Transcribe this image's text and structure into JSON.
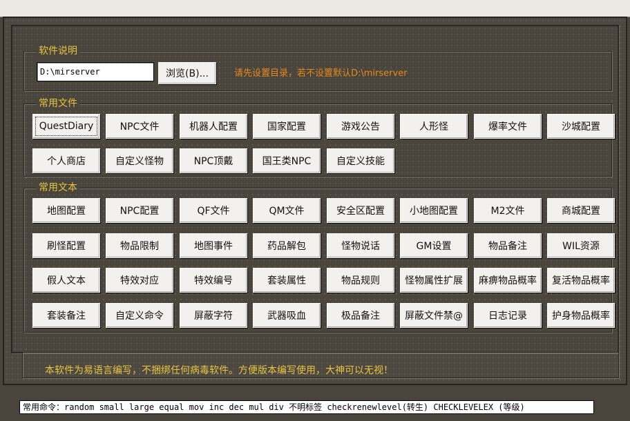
{
  "intro": {
    "title": "软件说明",
    "path_value": "D:\\mirserver",
    "browse_label": "浏览(B)...",
    "hint": "请先设置目录，若不设置默认D:\\mirserver"
  },
  "files": {
    "title": "常用文件",
    "buttons": [
      "QuestDiary",
      "NPC文件",
      "机器人配置",
      "国家配置",
      "游戏公告",
      "人形怪",
      "爆率文件",
      "沙城配置",
      "个人商店",
      "自定义怪物",
      "NPC顶戴",
      "国王类NPC",
      "自定义技能"
    ]
  },
  "texts": {
    "title": "常用文本",
    "buttons": [
      "地图配置",
      "NPC配置",
      "QF文件",
      "QM文件",
      "安全区配置",
      "小地图配置",
      "M2文件",
      "商城配置",
      "刷怪配置",
      "物品限制",
      "地图事件",
      "药品解包",
      "怪物说话",
      "GM设置",
      "物品备注",
      "WIL资源",
      "假人文本",
      "特效对应",
      "特效编号",
      "套装属性",
      "物品规则",
      "怪物属性扩展",
      "麻痹物品概率",
      "复活物品概率",
      "套装备注",
      "自定义命令",
      "屏蔽字符",
      "武器吸血",
      "极品备注",
      "屏蔽文件禁@",
      "日志记录",
      "护身物品概率"
    ]
  },
  "notice": "本软件为易语言编写，不捆绑任何病毒软件。方便版本编写使用，大神可以无视！",
  "command_bar": "常用命令：random small large equal mov inc dec mul div 不明标签 checkrenewlevel(转生) CHECKLEVELEX (等级)"
}
